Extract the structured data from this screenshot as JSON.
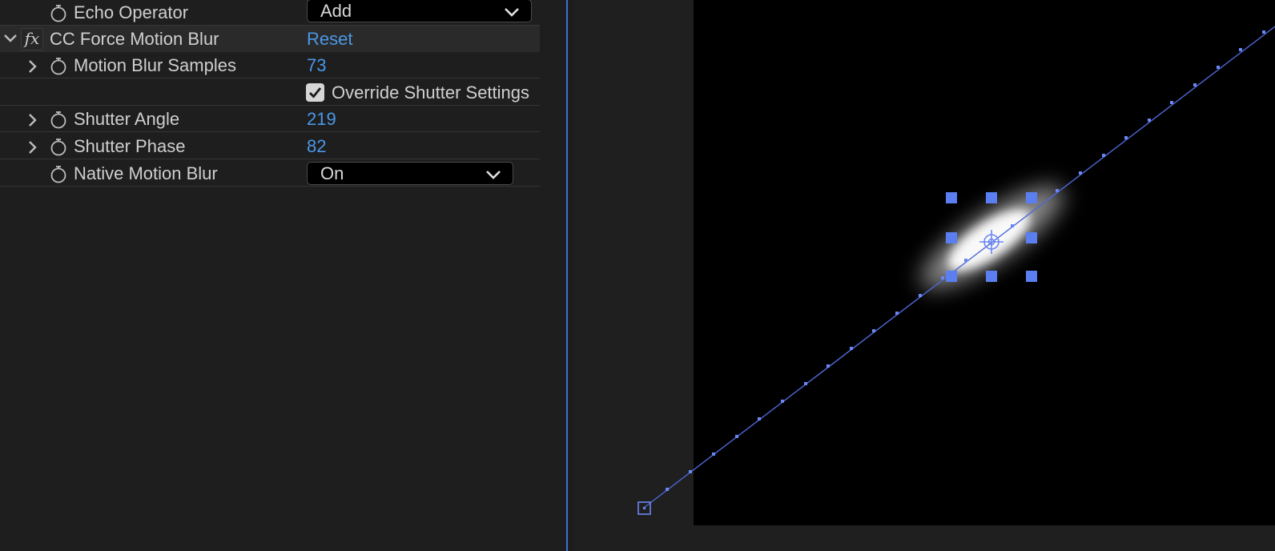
{
  "effect_controls": {
    "echo_operator": {
      "label": "Echo Operator",
      "value": "Add"
    },
    "effect": {
      "fx_badge": "fx",
      "name": "CC Force Motion Blur",
      "reset_label": "Reset"
    },
    "properties": {
      "motion_blur_samples": {
        "label": "Motion Blur Samples",
        "value": "73"
      },
      "override_shutter": {
        "label": "Override Shutter Settings",
        "checked": true
      },
      "shutter_angle": {
        "label": "Shutter Angle",
        "value": "219"
      },
      "shutter_phase": {
        "label": "Shutter Phase",
        "value": "82"
      },
      "native_motion_blur": {
        "label": "Native Motion Blur",
        "value": "On"
      }
    }
  },
  "icons": {
    "stopwatch": "stopwatch-icon",
    "twirl_open": "chevron-down-icon",
    "twirl_closed": "chevron-right-icon",
    "dropdown": "chevron-down-icon",
    "checkbox": "checkmark-icon",
    "anchor": "anchor-point-icon"
  },
  "colors": {
    "value_blue": "#4a98e8",
    "selection_blue": "#5b7ff0",
    "panel_bg": "#1e1e1e",
    "viewer_bg": "#1f1f1f",
    "composition_bg": "#000000"
  }
}
